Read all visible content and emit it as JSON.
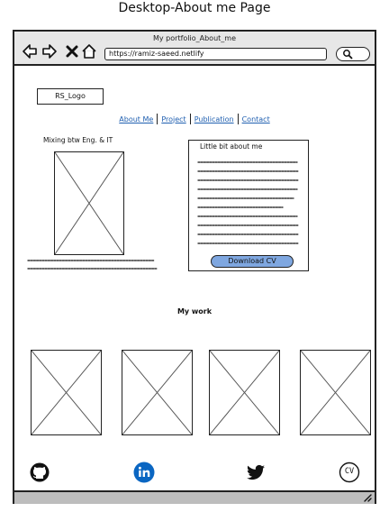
{
  "page": {
    "heading": "Desktop-About me Page"
  },
  "browser": {
    "window_title": "My portfolio_About_me",
    "address": "https://ramiz-saeed.netlify",
    "buttons": [
      "back",
      "forward",
      "close",
      "home"
    ]
  },
  "header": {
    "logo": "RS_Logo",
    "nav": [
      "About Me",
      "Project",
      "Publication",
      "Contact"
    ]
  },
  "left_section": {
    "caption": "Mixing btw Eng. & IT"
  },
  "about": {
    "title": "Little bit about me",
    "button": "Download CV"
  },
  "work": {
    "title": "My work",
    "items": 4
  },
  "footer": {
    "cv_label": "CV",
    "icons": [
      "github-icon",
      "linkedin-icon",
      "twitter-icon",
      "cv-icon"
    ]
  },
  "colors": {
    "accent": "#7fa7e0",
    "link": "#1f5fb0",
    "linkedin": "#0a66c2",
    "titlebar": "#e7e7e7",
    "statusbar": "#bdbdbd"
  }
}
